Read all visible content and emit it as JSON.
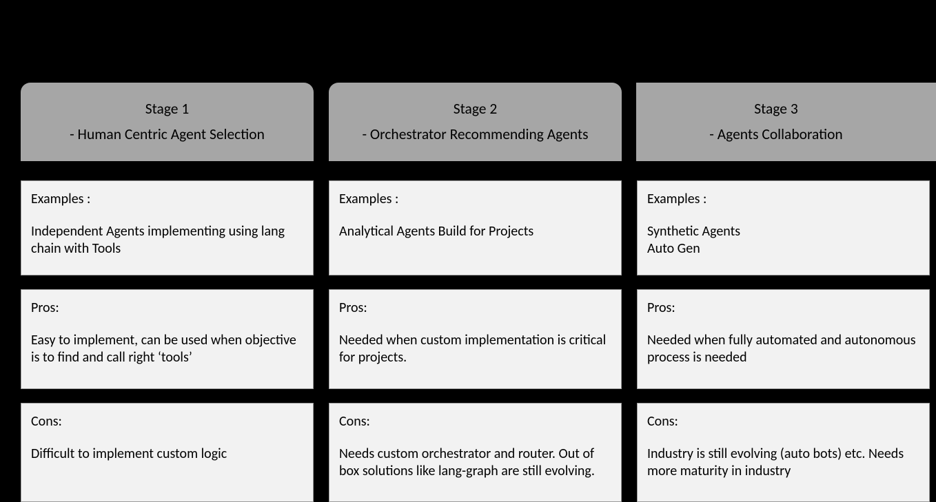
{
  "stages": [
    {
      "title": "Stage 1",
      "subtitle": "- Human Centric Agent Selection",
      "examples_heading": "Examples :",
      "examples_body": "Independent Agents implementing using lang chain with Tools",
      "pros_heading": "Pros:",
      "pros_body": "Easy to implement, can be used when objective is to find and call right ‘tools’",
      "cons_heading": "Cons:",
      "cons_body": "Difficult to implement custom logic"
    },
    {
      "title": "Stage 2",
      "subtitle": "- Orchestrator Recommending Agents",
      "examples_heading": "Examples :",
      "examples_body": "Analytical Agents Build for Projects",
      "pros_heading": "Pros:",
      "pros_body": "Needed when custom implementation is critical for projects.",
      "cons_heading": "Cons:",
      "cons_body": "Needs custom orchestrator and router. Out of box solutions like lang-graph are still evolving."
    },
    {
      "title": "Stage 3",
      "subtitle": "- Agents Collaboration",
      "examples_heading": "Examples :",
      "examples_body": "Synthetic Agents\nAuto Gen",
      "pros_heading": "Pros:",
      "pros_body": "Needed when fully automated and autonomous process is needed",
      "cons_heading": "Cons:",
      "cons_body": "Industry is still evolving (auto bots) etc. Needs more maturity in industry"
    }
  ]
}
